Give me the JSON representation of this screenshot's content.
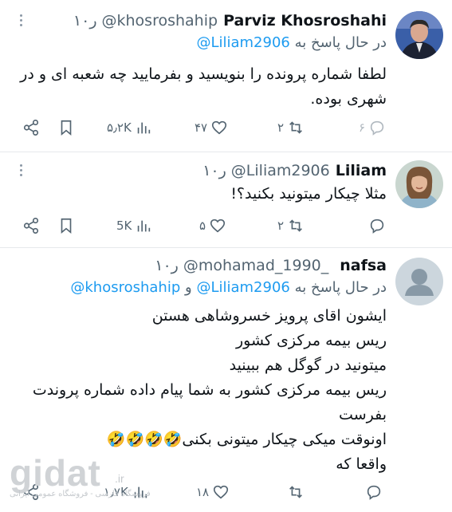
{
  "tweets": [
    {
      "name": "Parviz Khosroshahi",
      "handle": "@khosroshahip",
      "time": "۱۰ر",
      "reply_prefix": "در حال پاسخ به",
      "reply_mentions": [
        "@Liliam2906"
      ],
      "reply_joiner": "",
      "text_lines": [
        "لطفا شماره پرونده را بنویسید و بفرمایید چه شعبه ای و در",
        "شهری بوده."
      ],
      "stats": {
        "replies": "۶",
        "retweets": "۲",
        "likes": "۴۷",
        "views": "۵٫۲K"
      }
    },
    {
      "name": "Liliam",
      "handle": "@Liliam2906",
      "time": "۱۰ر",
      "text_lines": [
        "مثلا چیکار میتونید بکنید؟!"
      ],
      "stats": {
        "replies": "",
        "retweets": "۲",
        "likes": "۵",
        "views": "5K"
      }
    },
    {
      "name": "nafsa",
      "handle": "@mohamad_1990_",
      "time": "۱۰ر",
      "reply_prefix": "در حال پاسخ به",
      "reply_mentions": [
        "@Liliam2906",
        "@khosroshahip"
      ],
      "reply_joiner": "و",
      "text_lines": [
        "ایشون اقای پرویز خسروشاهی هستن",
        "ریس بیمه مرکزی کشور",
        "میتونید در گوگل هم ببینید",
        "ریس بیمه مرکزی کشور به شما پیام داده شماره پروندت",
        "بفرست",
        "اونوقت میکی چیکار میتونی بکنی🤣🤣🤣🤣",
        "واقعا که"
      ],
      "stats": {
        "replies": "",
        "retweets": "",
        "likes": "۱۸",
        "views": "۱٫۷K"
      }
    }
  ],
  "watermark": {
    "logo": "gidat",
    "domain": ".ir",
    "tagline": "فروشگاه فارسی - فروشگاه عمومی ایرانی"
  },
  "icons": [
    "reply-icon",
    "retweet-icon",
    "like-icon",
    "views-icon",
    "bookmark-icon",
    "share-icon",
    "more-icon"
  ]
}
